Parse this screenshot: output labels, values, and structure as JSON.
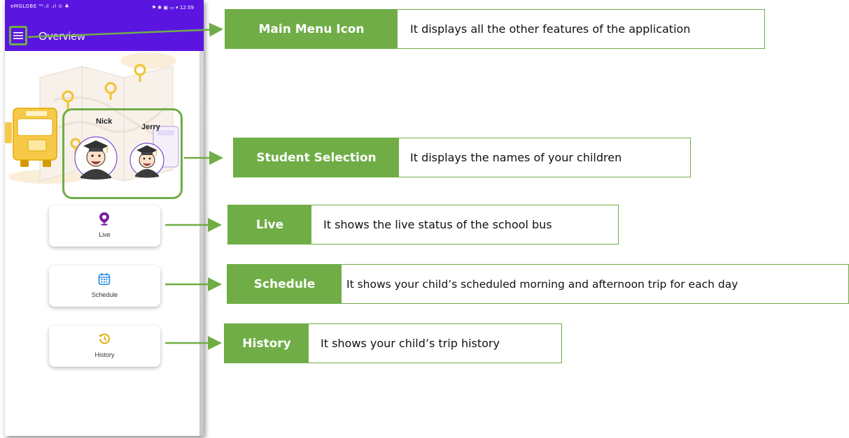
{
  "status_bar": {
    "left": "eMGLOBE ⁴ᴳ.ıl .ıl ⊙ ♣",
    "time": "12:59"
  },
  "appbar": {
    "menu_icon": "hamburger-menu-icon",
    "title": "Overview"
  },
  "students": [
    {
      "name": "Nick"
    },
    {
      "name": "Jerry"
    }
  ],
  "cards": [
    {
      "label": "Live",
      "icon": "location-pin-icon",
      "icon_color": "#7b1fa2"
    },
    {
      "label": "Schedule",
      "icon": "calendar-icon",
      "icon_color": "#1e88e5"
    },
    {
      "label": "History",
      "icon": "history-clock-icon",
      "icon_color": "#e0a800"
    }
  ],
  "callouts": [
    {
      "title": "Main Menu Icon",
      "description": "It displays all the other features of the application"
    },
    {
      "title": "Student Selection",
      "description": "It displays the names of your children"
    },
    {
      "title": "Live",
      "description": "It shows the live status of the school bus"
    },
    {
      "title": "Schedule",
      "description": "It shows your child’s scheduled morning and afternoon trip for each day"
    },
    {
      "title": "History",
      "description": "It shows your child’s trip history"
    }
  ],
  "colors": {
    "brand_purple": "#5b15e0",
    "callout_green": "#70ad47"
  }
}
